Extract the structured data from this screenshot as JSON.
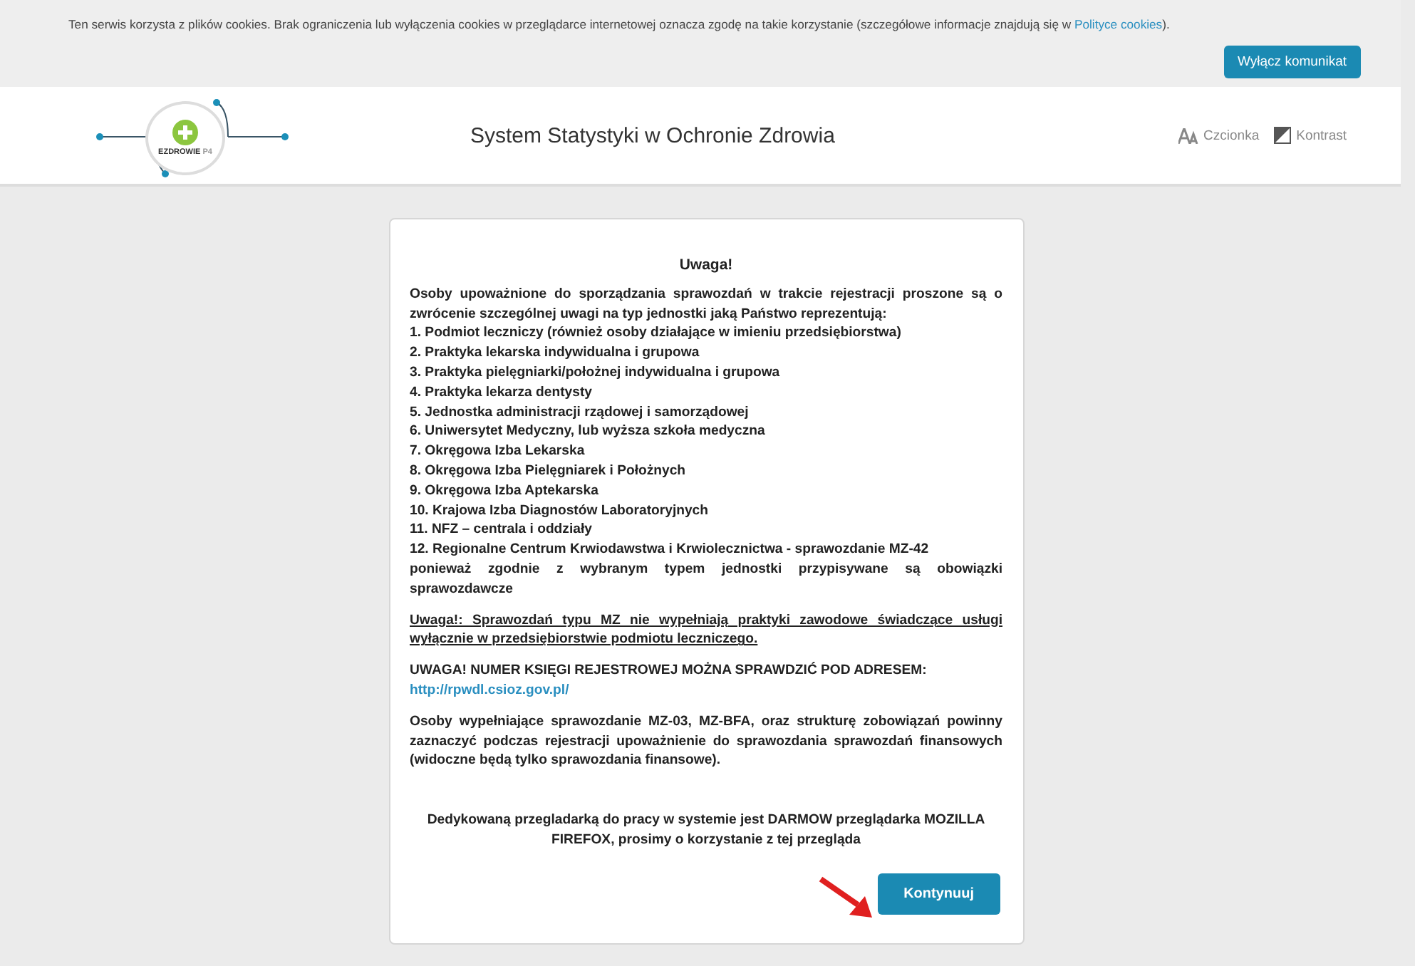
{
  "cookie_bar": {
    "text": "Ten serwis korzysta z plików cookies. Brak ograniczenia lub wyłączenia cookies w przeglądarce internetowej oznacza zgodę na takie korzystanie (szczegółowe informacje znajdują się w",
    "link": "Polityce cookies",
    "after": ").",
    "button": "Wyłącz komunikat"
  },
  "header": {
    "logo_text": "EZDROWIE",
    "logo_sub": "P4",
    "title": "System Statystyki w Ochronie Zdrowia",
    "tools": [
      {
        "kind": "font",
        "label": "Czcionka"
      },
      {
        "kind": "contrast",
        "label": "Kontrast"
      }
    ]
  },
  "notice": {
    "heading": "Uwaga!",
    "intro": "Osoby upoważnione do sporządzania sprawozdań w trakcie rejestracji proszone są o zwrócenie szczególnej uwagi na typ jednostki jaką Państwo reprezentują:",
    "items": [
      "1. Podmiot leczniczy (również osoby działające w imieniu przedsiębiorstwa)",
      "2. Praktyka lekarska indywidualna i grupowa",
      "3. Praktyka pielęgniarki/położnej indywidualna i grupowa",
      "4. Praktyka lekarza dentysty",
      "5. Jednostka administracji rządowej i samorządowej",
      "6. Uniwersytet Medyczny, lub wyższa szkoła medyczna",
      "7. Okręgowa Izba Lekarska",
      "8. Okręgowa Izba Pielęgniarek i Położnych",
      "9. Okręgowa Izba Aptekarska",
      "10. Krajowa Izba Diagnostów Laboratoryjnych",
      "11. NFZ – centrala i oddziały",
      "12. Regionalne Centrum Krwiodawstwa i Krwiolecznictwa - sprawozdanie MZ-42"
    ],
    "outro": "ponieważ zgodnie z wybranym typem jednostki przypisywane są obowiązki sprawozdawcze",
    "warning": "Uwaga!: Sprawozdań typu MZ nie wypełniają praktyki zawodowe świadczące usługi wyłącznie w przedsiębiorstwie podmiotu leczniczego.",
    "registry": "UWAGA! NUMER KSIĘGI REJESTROWEJ MOŻNA SPRAWDZIĆ POD ADRESEM:",
    "registry_link": "http://rpwdl.csioz.gov.pl/",
    "finance": "Osoby wypełniające sprawozdanie MZ-03, MZ-BFA, oraz strukturę zobowiązań powinny zaznaczyć podczas rejestracji upoważnienie do sprawozdania sprawozdań finansowych (widoczne będą tylko sprawozdania finansowe).",
    "browser_note_1": "Dedykowaną przegladarką do pracy w systemie jest DARMOW",
    "browser_note_2": "przeglądarka MOZILLA FIREFOX, prosimy o korzystanie z tej przegląda",
    "button": "Kontynuuj"
  }
}
